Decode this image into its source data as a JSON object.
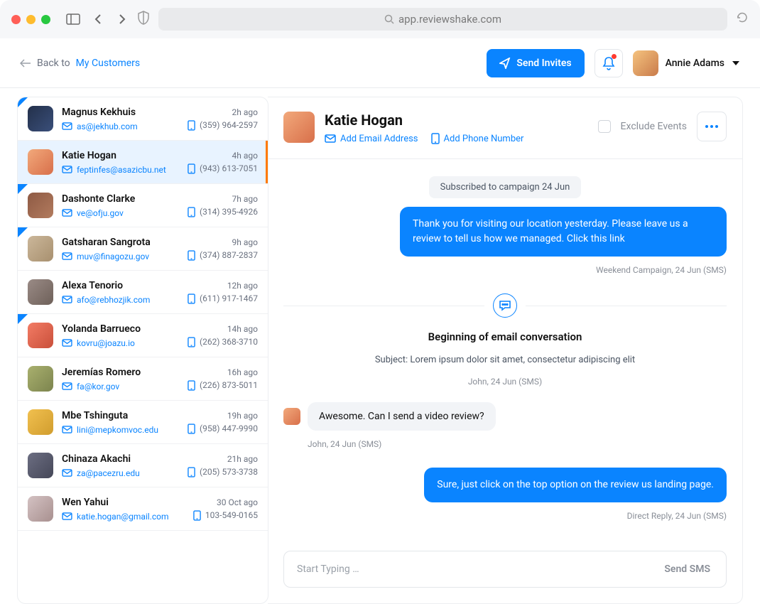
{
  "browser": {
    "url": "app.reviewshake.com"
  },
  "header": {
    "back_prefix": "Back to ",
    "back_link": "My Customers",
    "send_invites": "Send Invites",
    "user": "Annie Adams"
  },
  "customers": [
    {
      "name": "Magnus Kekhuis",
      "email": "as@jekhub.com",
      "time": "2h ago",
      "phone": "(359) 964-2597",
      "note": true,
      "av": "av0"
    },
    {
      "name": "Katie Hogan",
      "email": "feptinfes@asazicbu.net",
      "time": "4h ago",
      "phone": "(943) 613-7051",
      "selected": true,
      "av": "av1"
    },
    {
      "name": "Dashonte Clarke",
      "email": "ve@ofju.gov",
      "time": "7h ago",
      "phone": "(314) 395-4926",
      "note": true,
      "av": "av2"
    },
    {
      "name": "Gatsharan Sangrota",
      "email": "muv@finagozu.gov",
      "time": "9h ago",
      "phone": "(374) 887-2837",
      "note": true,
      "av": "av3"
    },
    {
      "name": "Alexa Tenorio",
      "email": "afo@rebhozjik.com",
      "time": "12h ago",
      "phone": "(611) 917-1467",
      "av": "av4"
    },
    {
      "name": "Yolanda Barrueco",
      "email": "kovru@joazu.io",
      "time": "14h ago",
      "phone": "(262) 368-3710",
      "note": true,
      "av": "av5"
    },
    {
      "name": "Jeremías Romero",
      "email": "fa@kor.gov",
      "time": "16h ago",
      "phone": "(226) 873-5011",
      "av": "av6"
    },
    {
      "name": "Mbe Tshinguta",
      "email": "lini@mepkomvoc.edu",
      "time": "19h ago",
      "phone": "(958) 447-9990",
      "av": "av7"
    },
    {
      "name": "Chinaza Akachi",
      "email": "za@pacezru.edu",
      "time": "21h ago",
      "phone": "(205) 573-3738",
      "av": "av8"
    },
    {
      "name": "Wen Yahui",
      "email": "katie.hogan@gmail.com",
      "time": "30 Oct ago",
      "phone": "103-549-0165",
      "av": "av9"
    }
  ],
  "conversation": {
    "name": "Katie Hogan",
    "add_email": "Add Email Address",
    "add_phone": "Add Phone Number",
    "exclude_label": "Exclude Events",
    "system_pill": "Subscribed to campaign 24 Jun",
    "out1": "Thank you for visiting our location yesterday. Please leave us a review to tell us how we managed. Click this link",
    "out1_meta": "Weekend Campaign, 24 Jun (SMS)",
    "start_title": "Beginning of email conversation",
    "subject": "Subject: Lorem ipsum dolor sit amet, consectetur adipiscing elit",
    "start_meta": "John, 24 Jun (SMS)",
    "in1": "Awesome. Can I send a video review?",
    "in1_meta": "John, 24 Jun (SMS)",
    "out2": "Sure, just click on the top option on the review us landing page.",
    "out2_meta": "Direct Reply, 24 Jun (SMS)",
    "compose_placeholder": "Start Typing …",
    "send_label": "Send SMS"
  }
}
